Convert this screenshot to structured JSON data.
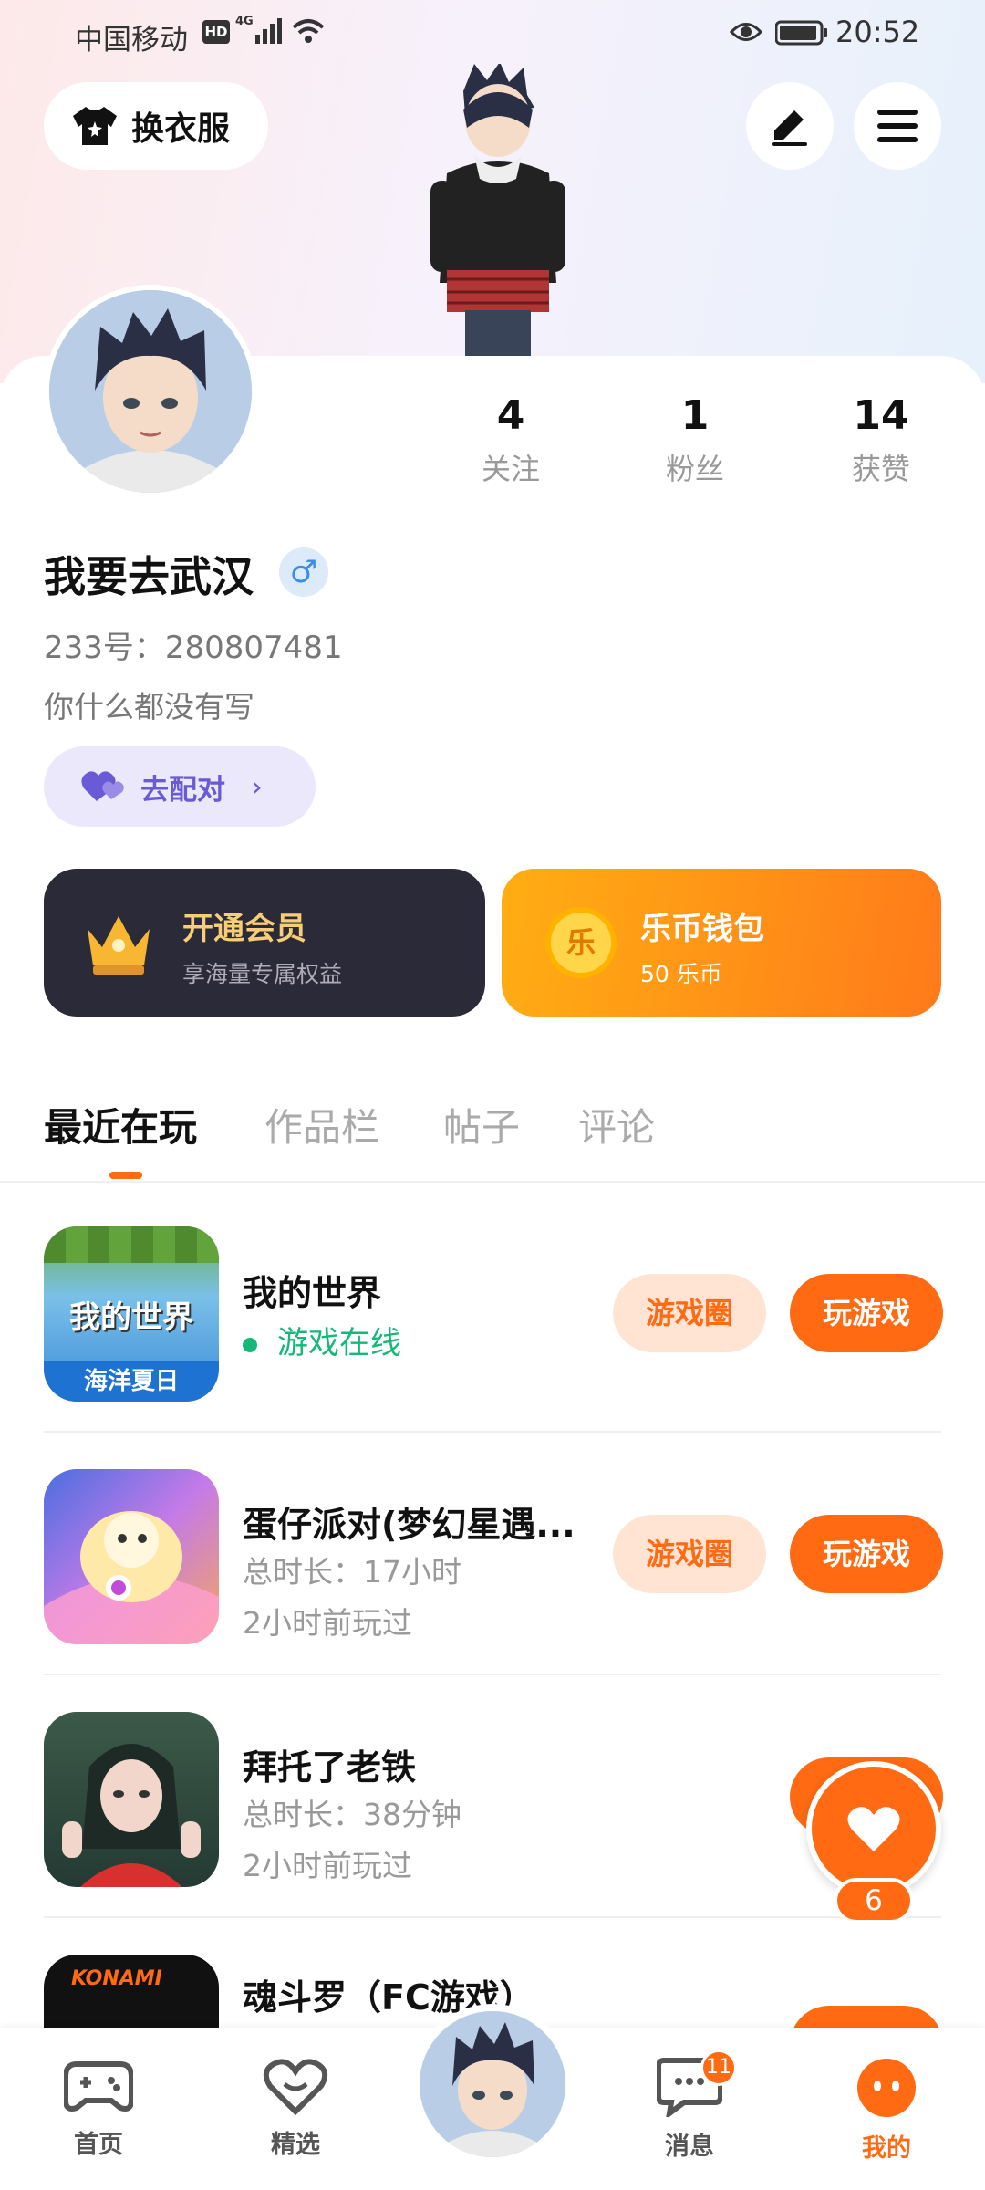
{
  "status_bar": {
    "carrier": "中国移动",
    "hd": "HD",
    "network": "4G",
    "time": "20:52"
  },
  "header": {
    "outfit_label": "换衣服",
    "edit_icon": "pen-icon",
    "menu_icon": "menu-icon"
  },
  "profile": {
    "username": "我要去武汉",
    "gender_symbol": "♂",
    "uid": "233号：280807481",
    "bio": "你什么都没有写",
    "match_label": "去配对",
    "stats": [
      {
        "num": "4",
        "label": "关注"
      },
      {
        "num": "1",
        "label": "粉丝"
      },
      {
        "num": "14",
        "label": "获赞"
      }
    ]
  },
  "cards": {
    "vip": {
      "title": "开通会员",
      "sub": "享海量专属权益"
    },
    "wallet": {
      "title": "乐币钱包",
      "sub": "50 乐币",
      "coin_char": "乐"
    }
  },
  "tabs": [
    "最近在玩",
    "作品栏",
    "帖子",
    "评论"
  ],
  "games": [
    {
      "title": "我的世界",
      "status": "游戏在线",
      "icon_text_top": "我的世界",
      "icon_text_bottom": "海洋夏日"
    },
    {
      "title": "蛋仔派对(梦幻星遇...",
      "duration": "总时长：17小时",
      "last": "2小时前玩过"
    },
    {
      "title": "拜托了老铁",
      "duration": "总时长：38分钟",
      "last": "2小时前玩过"
    },
    {
      "title": "魂斗罗（FC游戏）",
      "icon_brand": "KONAMI"
    }
  ],
  "game_buttons": {
    "circle": "游戏圈",
    "play": "玩游戏"
  },
  "like_float": {
    "count": "6"
  },
  "bottom_nav": {
    "items": [
      "首页",
      "精选",
      "消息",
      "我的"
    ],
    "message_badge": "11"
  },
  "colors": {
    "accent": "#ff6a13",
    "vip_bg": "#2b2a39",
    "vip_gold": "#f8cd77",
    "online_green": "#14b878",
    "match_purple": "#6a5ad6"
  }
}
